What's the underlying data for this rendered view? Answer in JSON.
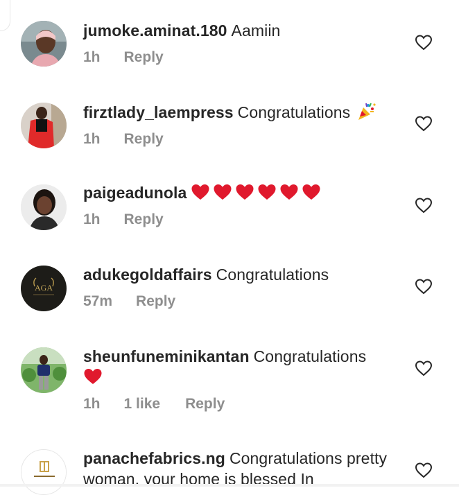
{
  "comments": [
    {
      "username": "jumoke.aminat.180",
      "text": "Aamiin",
      "time": "1h",
      "likes": "",
      "reply": "Reply",
      "avatar": "user-photo"
    },
    {
      "username": "firztlady_laempress",
      "text": "Congratulations",
      "emoji": "party-popper",
      "time": "1h",
      "likes": "",
      "reply": "Reply",
      "avatar": "user-photo"
    },
    {
      "username": "paigeadunola",
      "text": "",
      "hearts": 6,
      "time": "1h",
      "likes": "",
      "reply": "Reply",
      "avatar": "user-photo"
    },
    {
      "username": "adukegoldaffairs",
      "text": "Congratulations",
      "time": "57m",
      "likes": "",
      "reply": "Reply",
      "avatar": "brand-logo-aga",
      "avatar_text": "AGA"
    },
    {
      "username": "sheunfuneminikantan",
      "text": "Congratulations",
      "trailing_hearts": 1,
      "time": "1h",
      "likes": "1 like",
      "reply": "Reply",
      "avatar": "user-photo"
    },
    {
      "username": "panachefabrics.ng",
      "text": "Congratulations pretty woman, your home is blessed In",
      "time": "",
      "likes": "",
      "reply": "",
      "avatar": "brand-logo-panache"
    }
  ],
  "colors": {
    "text": "#262626",
    "meta": "#8e8e8e",
    "heart": "#e0192d",
    "like_outline": "#262626"
  }
}
